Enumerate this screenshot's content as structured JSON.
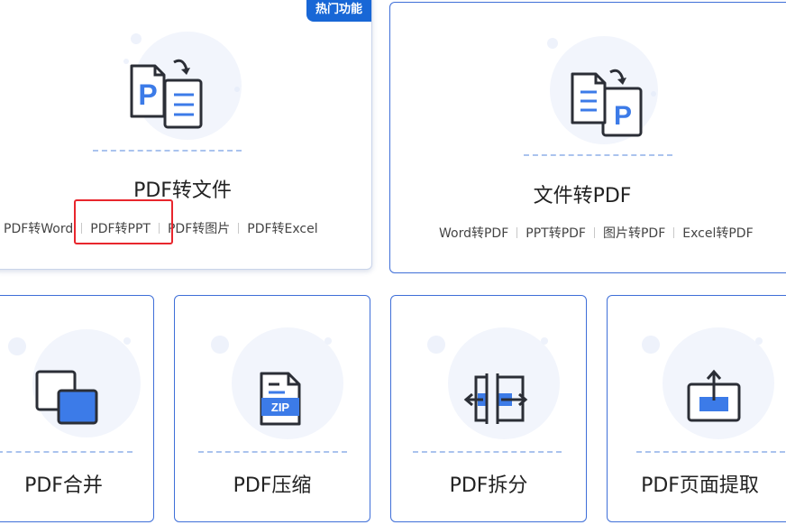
{
  "badge_hot": "热门功能",
  "card_pdf_to_file": {
    "title": "PDF转文件",
    "links": [
      "PDF转Word",
      "PDF转PPT",
      "PDF转图片",
      "PDF转Excel"
    ]
  },
  "card_file_to_pdf": {
    "title": "文件转PDF",
    "links": [
      "Word转PDF",
      "PPT转PDF",
      "图片转PDF",
      "Excel转PDF"
    ]
  },
  "card_merge": {
    "title": "PDF合并"
  },
  "card_compress": {
    "title": "PDF压缩",
    "zip_label": "ZIP"
  },
  "card_split": {
    "title": "PDF拆分"
  },
  "card_extract": {
    "title": "PDF页面提取"
  },
  "pdf_letter": "P",
  "colors": {
    "accent": "#3c7be8",
    "border": "#3f6fd8",
    "badge": "#1867d6",
    "highlight": "#e8262d",
    "icon_dark": "#2b2e36"
  }
}
